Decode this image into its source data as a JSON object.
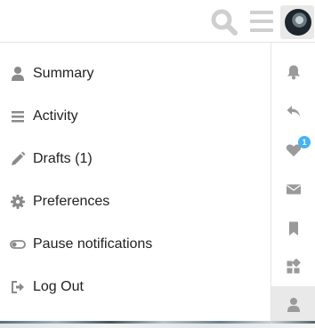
{
  "header": {
    "search_icon": "search-icon",
    "menu_icon": "hamburger-icon",
    "avatar_icon": "user-avatar"
  },
  "user_menu": {
    "items": [
      {
        "label": "Summary",
        "icon": "user-icon"
      },
      {
        "label": "Activity",
        "icon": "list-icon"
      },
      {
        "label": "Drafts (1)",
        "icon": "pencil-icon"
      },
      {
        "label": "Preferences",
        "icon": "gear-icon"
      },
      {
        "label": "Pause notifications",
        "icon": "toggle-icon"
      },
      {
        "label": "Log Out",
        "icon": "sign-out-icon"
      }
    ]
  },
  "quick_access": {
    "tabs": [
      {
        "icon": "bell-icon"
      },
      {
        "icon": "reply-icon"
      },
      {
        "icon": "heart-icon",
        "badge": "1"
      },
      {
        "icon": "envelope-icon"
      },
      {
        "icon": "bookmark-icon"
      },
      {
        "icon": "chat-tiles-icon"
      },
      {
        "icon": "user-icon",
        "active": true
      }
    ]
  },
  "colors": {
    "icon_gray": "#9a9a9a",
    "menu_icon_gray": "#8a8a8a",
    "badge_blue": "#45b3f4",
    "active_tab_bg": "#e9e9e9",
    "divider": "#e5e5e5"
  }
}
